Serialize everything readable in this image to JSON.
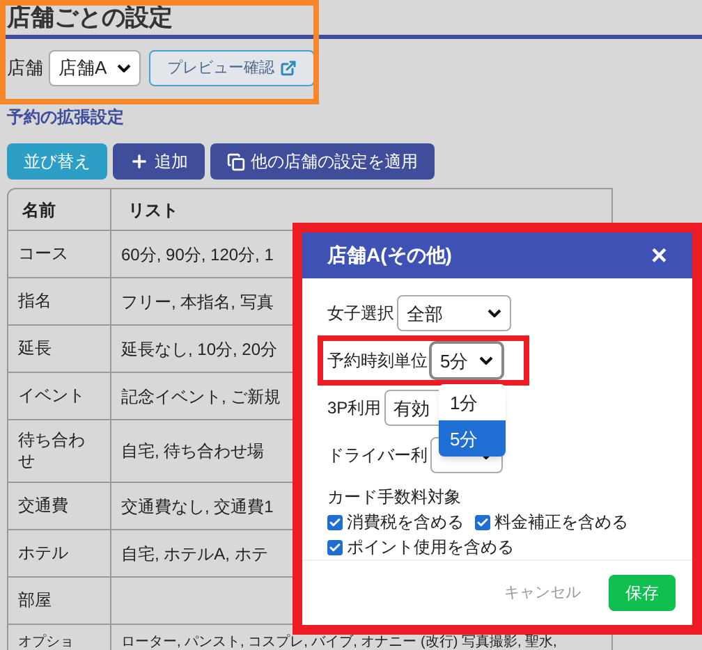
{
  "page": {
    "title": "店舗ごとの設定",
    "store_label": "店舗",
    "store_select": {
      "value": "店舗A"
    },
    "preview_button": "プレビュー確認",
    "section_link": "予約の拡張設定"
  },
  "toolbar": [
    {
      "kind": "sort",
      "label": "並び替え"
    },
    {
      "kind": "add",
      "label": "追加"
    },
    {
      "kind": "copy",
      "label": "他の店舗の設定を適用"
    }
  ],
  "table": {
    "columns": [
      "名前",
      "リスト"
    ],
    "rows": [
      {
        "name": "コース",
        "list": "60分, 90分, 120分, 1"
      },
      {
        "name": "指名",
        "list": "フリー, 本指名, 写真"
      },
      {
        "name": "延長",
        "list": "延長なし, 10分, 20分"
      },
      {
        "name": "イベント",
        "list": "記念イベント, ご新規"
      },
      {
        "name": "待ち合わせ",
        "list": "自宅, 待ち合わせ場"
      },
      {
        "name": "交通費",
        "list": "交通費なし, 交通費1"
      },
      {
        "name": "ホテル",
        "list": "自宅, ホテルA, ホテ"
      },
      {
        "name": "部屋",
        "list": ""
      },
      {
        "name": "オプショ",
        "list": "ローター, パンスト, コスプレ, バイブ, オナニー (改行) 写真撮影, 聖水,"
      }
    ]
  },
  "modal": {
    "title": "店舗A(その他)",
    "close": "×",
    "fields": [
      {
        "label": "女子選択",
        "value": "全部",
        "open": false,
        "highlighted": false
      },
      {
        "label": "予約時刻単位",
        "value": "5分",
        "open": true,
        "highlighted": true,
        "options": [
          {
            "label": "1分",
            "selected": false
          },
          {
            "label": "5分",
            "selected": true
          }
        ]
      },
      {
        "label": "3P利用",
        "value": "有効",
        "open": false,
        "highlighted": false
      },
      {
        "label": "ドライバー利",
        "open": false,
        "highlighted": false
      }
    ],
    "checkbox_group": {
      "label": "カード手数料対象",
      "items": [
        {
          "label": "消費税を含める",
          "checked": true
        },
        {
          "label": "料金補正を含める",
          "checked": true
        },
        {
          "label": "ポイント使用を含める",
          "checked": true
        }
      ]
    },
    "cancel": "キャンセル",
    "save": "保存"
  }
}
